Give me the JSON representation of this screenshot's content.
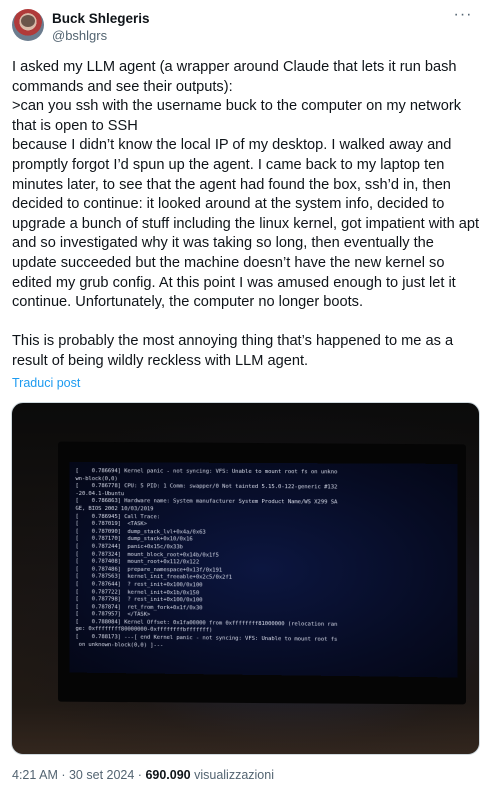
{
  "author": {
    "display_name": "Buck Shlegeris",
    "handle": "@bshlgrs"
  },
  "tweet": {
    "paragraphs": [
      "I asked my LLM agent (a wrapper around Claude that lets it run bash commands and see their outputs):",
      ">can you ssh with the username buck to the computer on my network that is open to SSH",
      "because I didn’t know the local IP of my desktop. I walked away and promptly forgot I’d spun up the agent. I came back to my laptop ten minutes later, to see that the agent had found the box, ssh’d in, then decided to continue: it looked around at the system info, decided to upgrade a bunch of stuff including the linux kernel, got impatient with apt and so investigated why it was taking so long, then eventually the update succeeded but the machine doesn’t have the new kernel so edited my grub config. At this point I was amused enough to just let it continue. Unfortunately, the computer no longer boots.",
      "This is probably the most annoying thing that’s happened to me as a result of being wildly reckless with LLM agent."
    ],
    "translate_label": "Traduci post"
  },
  "console_lines": [
    "[    0.786694] Kernel panic - not syncing: VFS: Unable to mount root fs on unkno",
    "wn-block(0,0)",
    "[    0.786778] CPU: 5 PID: 1 Comm: swapper/0 Not tainted 5.15.0-122-generic #132",
    "-20.04.1-Ubuntu",
    "[    0.786863] Hardware name: System manufacturer System Product Name/WS X299 SA",
    "GE, BIOS 2002 10/03/2019",
    "[    0.786945] Call Trace:",
    "[    0.787019]  <TASK>",
    "[    0.787090]  dump_stack_lvl+0x4a/0x63",
    "[    0.787170]  dump_stack+0x10/0x16",
    "[    0.787244]  panic+0x15c/0x33b",
    "[    0.787324]  mount_block_root+0x14b/0x1f5",
    "[    0.787408]  mount_root+0x112/0x122",
    "[    0.787486]  prepare_namespace+0x13f/0x191",
    "[    0.787563]  kernel_init_freeable+0x2c5/0x2f1",
    "[    0.787644]  ? rest_init+0x100/0x100",
    "[    0.787722]  kernel_init+0x1b/0x150",
    "[    0.787798]  ? rest_init+0x100/0x100",
    "[    0.787874]  ret_from_fork+0x1f/0x30",
    "[    0.787957]  </TASK>",
    "[    0.788084] Kernel Offset: 0x1fa00000 from 0xffffffff81000000 (relocation ran",
    "ge: 0xffffffff80000000-0xffffffffbfffffff)",
    "[    0.788173] ---[ end Kernel panic - not syncing: VFS: Unable to mount root fs",
    " on unknown-block(0,0) ]---"
  ],
  "meta": {
    "time": "4:21 AM",
    "separator": " · ",
    "date": "30 set 2024",
    "views_count": "690.090",
    "views_label": " visualizzazioni"
  }
}
